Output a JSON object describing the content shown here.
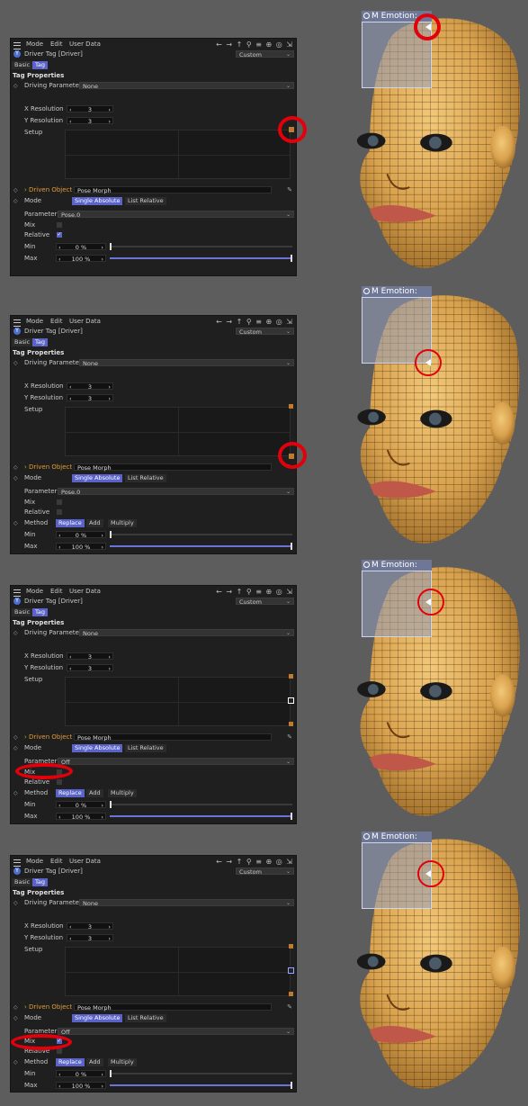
{
  "menu": {
    "mode": "Mode",
    "edit": "Edit",
    "user_data": "User Data"
  },
  "header": {
    "title": "Driver Tag [Driver]",
    "preset": "Custom"
  },
  "tabs": {
    "basic": "Basic",
    "tag": "Tag"
  },
  "section": "Tag Properties",
  "driving_parameter": {
    "label": "Driving Parameter",
    "value": "None"
  },
  "x_res": {
    "label": "X Resolution",
    "value": "3"
  },
  "y_res": {
    "label": "Y Resolution",
    "value": "3"
  },
  "setup_label": "Setup",
  "driven_object": {
    "label": "Driven Object",
    "value": "Pose Morph"
  },
  "mode": {
    "label": "Mode",
    "single": "Single Absolute",
    "list": "List Relative"
  },
  "parameter": {
    "label": "Parameter",
    "value1": "Pose.0",
    "value2": "Pose.0",
    "value3": "Off",
    "value4": "Off"
  },
  "mix_label": "Mix",
  "relative_label": "Relative",
  "method": {
    "label": "Method",
    "replace": "Replace",
    "add": "Add",
    "multiply": "Multiply"
  },
  "min": {
    "label": "Min",
    "value": "0 %"
  },
  "max": {
    "label": "Max",
    "value": "100 %"
  },
  "viewport": {
    "prefix": "M",
    "title": "Emotion:"
  },
  "colors": {
    "accent": "#5a63c8",
    "highlight": "#e3000b",
    "skin": "#d9a24e"
  }
}
